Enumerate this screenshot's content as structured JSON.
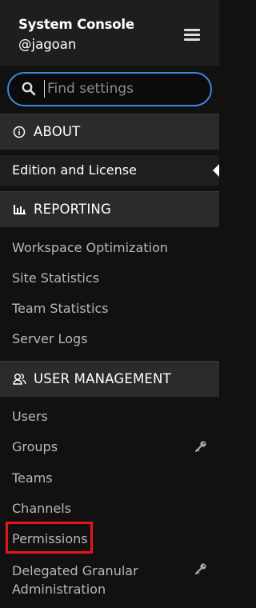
{
  "header": {
    "title": "System Console",
    "username": "@jagoan",
    "menu_icon": "hamburger-icon"
  },
  "search": {
    "placeholder": "Find settings",
    "value": "",
    "icon": "search-icon"
  },
  "sections": {
    "about": {
      "label": "ABOUT",
      "icon": "info-icon",
      "items": [
        "Edition and License"
      ]
    },
    "reporting": {
      "label": "REPORTING",
      "icon": "bar-chart-icon",
      "items": [
        "Workspace Optimization",
        "Site Statistics",
        "Team Statistics",
        "Server Logs"
      ]
    },
    "user_management": {
      "label": "USER MANAGEMENT",
      "icon": "users-icon",
      "items": [
        "Users",
        "Groups",
        "Teams",
        "Channels",
        "Permissions",
        "Delegated Granular Administration"
      ]
    }
  },
  "active_item": "Edition and License",
  "highlighted_item": "Permissions",
  "colors": {
    "background": "#111111",
    "header": "#1e1e1e",
    "section": "#2b2b2b",
    "search_border": "#3d87e0",
    "highlight": "#e8141c"
  }
}
